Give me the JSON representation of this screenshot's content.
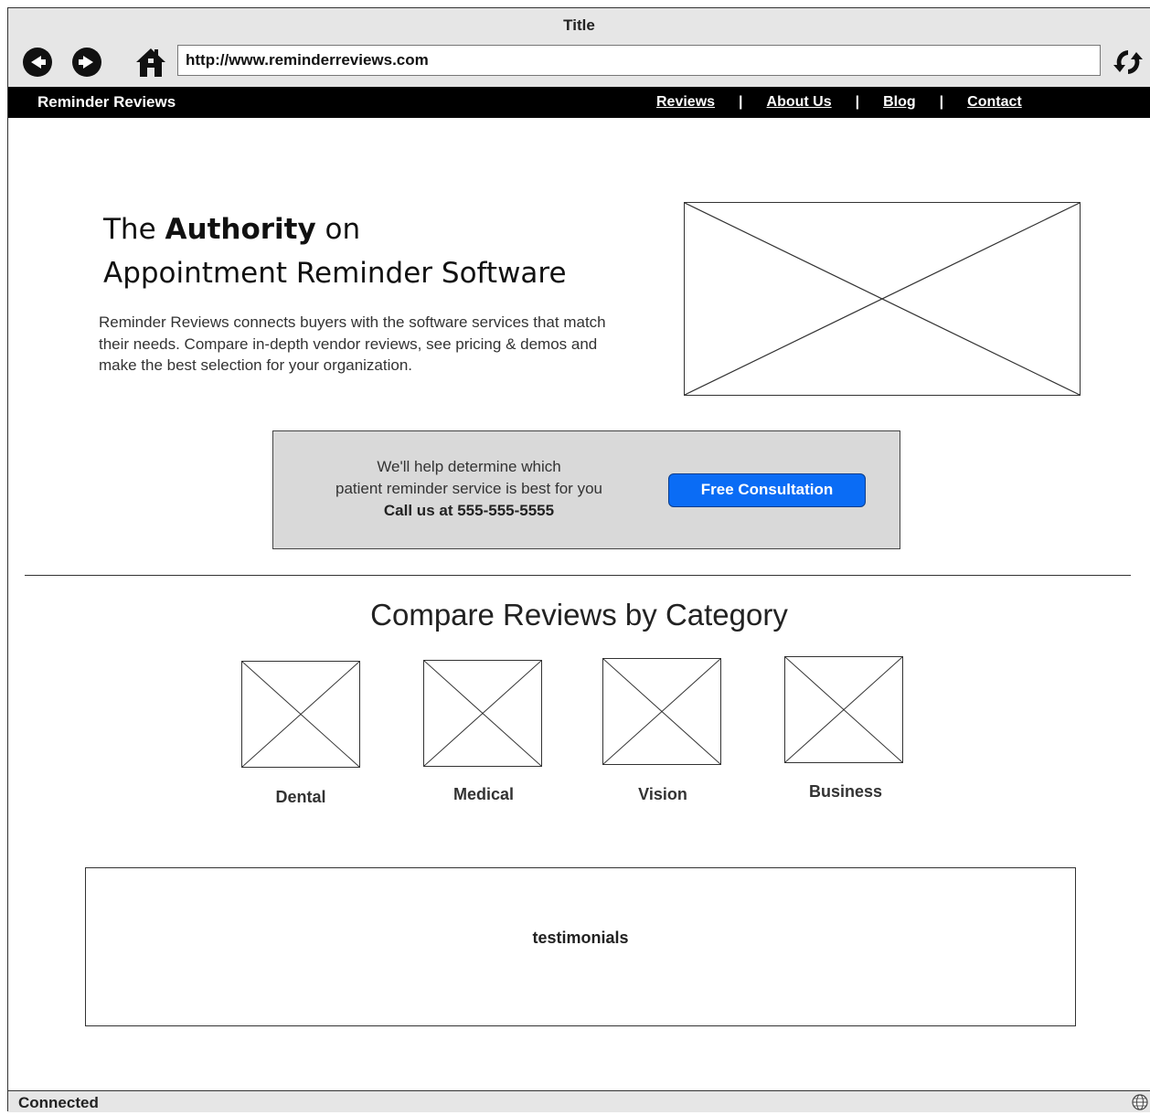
{
  "window": {
    "title": "Title"
  },
  "browser": {
    "url": "http://www.reminderreviews.com",
    "icons": {
      "back": "back-arrow-icon",
      "forward": "forward-arrow-icon",
      "home": "home-icon",
      "refresh": "refresh-icon"
    }
  },
  "site": {
    "brand": "Reminder Reviews",
    "nav": [
      {
        "label": "Reviews"
      },
      {
        "label": "About Us"
      },
      {
        "label": "Blog"
      },
      {
        "label": "Contact"
      }
    ],
    "nav_separator": "|"
  },
  "hero": {
    "headline_pre": "The ",
    "headline_bold": "Authority",
    "headline_post": " on",
    "headline_line2": "Appointment Reminder Software",
    "description": "Reminder Reviews connects buyers with the software services that match their needs. Compare in-depth vendor reviews, see pricing & demos and make the best selection for your organization."
  },
  "cta": {
    "line1": "We'll help determine which",
    "line2": "patient reminder service is best for you",
    "line3": "Call us at 555-555-5555",
    "button_label": "Free Consultation",
    "button_color": "#0a6cf5",
    "panel_color": "#d9d9d9"
  },
  "categories": {
    "title": "Compare Reviews by Category",
    "items": [
      {
        "label": "Dental"
      },
      {
        "label": "Medical"
      },
      {
        "label": "Vision"
      },
      {
        "label": "Business"
      }
    ]
  },
  "testimonials": {
    "label": "testimonials"
  },
  "status": {
    "text": "Connected",
    "icon": "globe-icon"
  }
}
